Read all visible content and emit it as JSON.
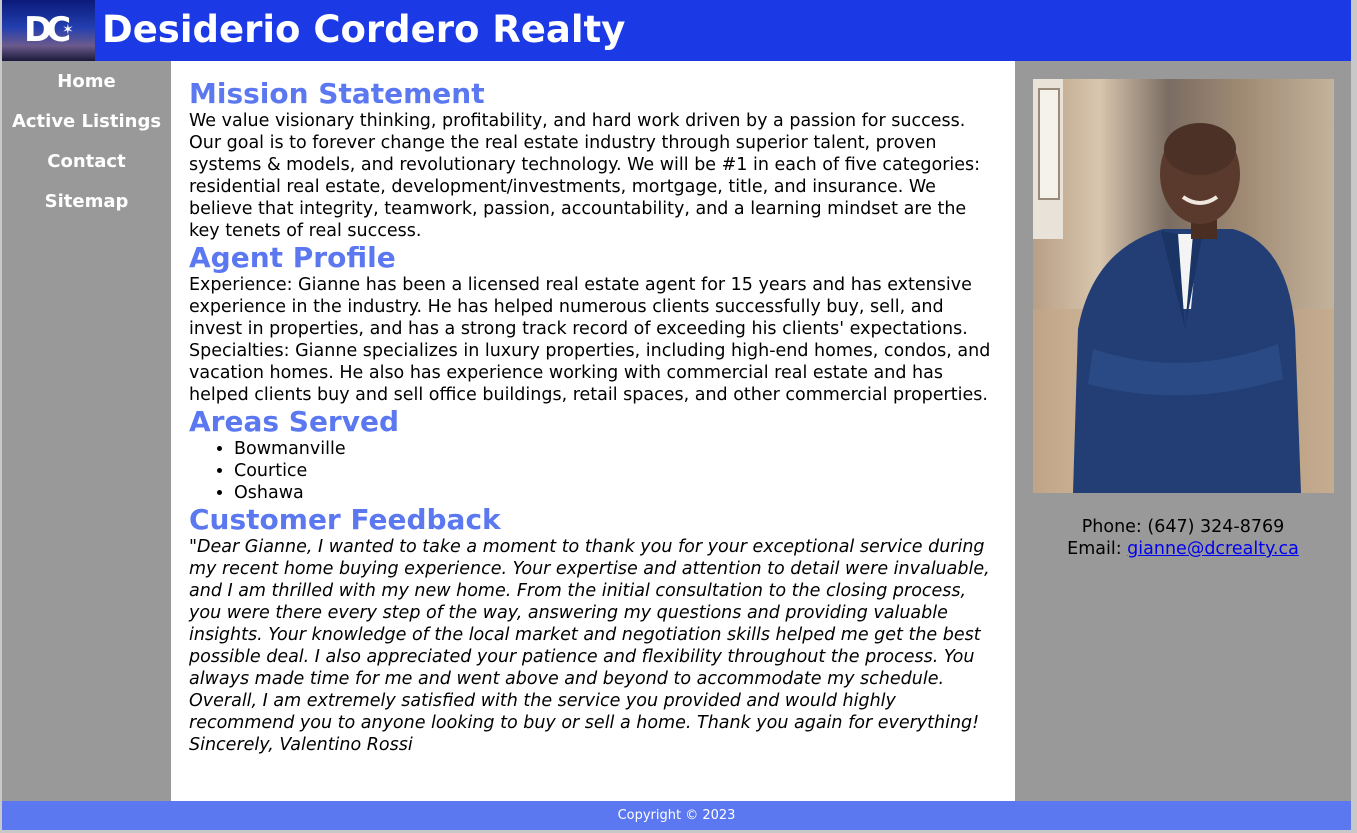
{
  "header": {
    "logo_text": "DC",
    "title": "Desiderio Cordero Realty"
  },
  "nav": {
    "items": [
      {
        "label": "Home"
      },
      {
        "label": "Active Listings"
      },
      {
        "label": "Contact"
      },
      {
        "label": "Sitemap"
      }
    ]
  },
  "main": {
    "mission": {
      "heading": "Mission Statement",
      "text": "We value visionary thinking, profitability, and hard work driven by a passion for success. Our goal is to forever change the real estate industry through superior talent, proven systems & models, and revolutionary technology. We will be #1 in each of five categories: residential real estate, development/investments, mortgage, title, and insurance. We believe that integrity, teamwork, passion, accountability, and a learning mindset are the key tenets of real success."
    },
    "profile": {
      "heading": "Agent Profile",
      "text": "Experience: Gianne has been a licensed real estate agent for 15 years and has extensive experience in the industry. He has helped numerous clients successfully buy, sell, and invest in properties, and has a strong track record of exceeding his clients' expectations. Specialties: Gianne specializes in luxury properties, including high-end homes, condos, and vacation homes. He also has experience working with commercial real estate and has helped clients buy and sell office buildings, retail spaces, and other commercial properties."
    },
    "areas": {
      "heading": "Areas Served",
      "items": [
        "Bowmanville",
        "Courtice",
        "Oshawa"
      ]
    },
    "feedback": {
      "heading": "Customer Feedback",
      "text": "\"Dear Gianne, I wanted to take a moment to thank you for your exceptional service during my recent home buying experience. Your expertise and attention to detail were invaluable, and I am thrilled with my new home. From the initial consultation to the closing process, you were there every step of the way, answering my questions and providing valuable insights. Your knowledge of the local market and negotiation skills helped me get the best possible deal. I also appreciated your patience and flexibility throughout the process. You always made time for me and went above and beyond to accommodate my schedule. Overall, I am extremely satisfied with the service you provided and would highly recommend you to anyone looking to buy or sell a home. Thank you again for everything! Sincerely, Valentino Rossi"
    }
  },
  "aside": {
    "phone_label": "Phone: ",
    "phone": "(647) 324-8769",
    "email_label": "Email: ",
    "email": "gianne@dcrealty.ca"
  },
  "footer": {
    "text": "Copyright © 2023"
  },
  "colors": {
    "header_bg": "#1b3ae6",
    "accent": "#5b78f0",
    "sidebar_bg": "#999999"
  }
}
